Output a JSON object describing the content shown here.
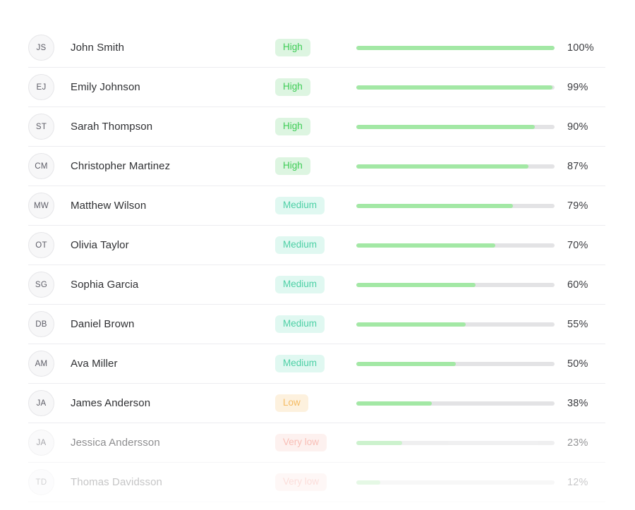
{
  "colors": {
    "background": "#ffffff",
    "divider": "#ededf0",
    "avatar_bg": "#f7f7f8",
    "avatar_border": "#e6e6e9",
    "avatar_text": "#5c5c66",
    "name_text": "#2f3033",
    "pct_text": "#3a3b3f",
    "bar_track": "#e3e3e5",
    "bar_fill": "#a3e8a5",
    "badge_high_bg": "#ddf5e1",
    "badge_high_text": "#3ecc56",
    "badge_medium_bg": "#e0f8f1",
    "badge_medium_text": "#4cd0a5",
    "badge_low_bg": "#fdf1de",
    "badge_low_text": "#f5bb62",
    "badge_verylow_bg": "#fde6e2",
    "badge_verylow_text": "#f4897c"
  },
  "chart_data": {
    "type": "bar",
    "title": "",
    "xlabel": "",
    "ylabel": "",
    "categories": [
      "John Smith",
      "Emily Johnson",
      "Sarah Thompson",
      "Christopher Martinez",
      "Matthew Wilson",
      "Olivia Taylor",
      "Sophia Garcia",
      "Daniel Brown",
      "Ava Miller",
      "James Anderson",
      "Jessica Andersson",
      "Thomas Davidsson"
    ],
    "values": [
      100,
      99,
      90,
      87,
      79,
      70,
      60,
      55,
      50,
      38,
      23,
      12
    ],
    "ylim": [
      0,
      100
    ],
    "grid": false,
    "legend": "none"
  },
  "rows": [
    {
      "initials": "JS",
      "name": "John Smith",
      "rating": "High",
      "rating_level": "high",
      "percent": 100,
      "percent_label": "100%",
      "fade": "none"
    },
    {
      "initials": "EJ",
      "name": "Emily Johnson",
      "rating": "High",
      "rating_level": "high",
      "percent": 99,
      "percent_label": "99%",
      "fade": "none"
    },
    {
      "initials": "ST",
      "name": "Sarah Thompson",
      "rating": "High",
      "rating_level": "high",
      "percent": 90,
      "percent_label": "90%",
      "fade": "none"
    },
    {
      "initials": "CM",
      "name": "Christopher Martinez",
      "rating": "High",
      "rating_level": "high",
      "percent": 87,
      "percent_label": "87%",
      "fade": "none"
    },
    {
      "initials": "MW",
      "name": "Matthew Wilson",
      "rating": "Medium",
      "rating_level": "medium",
      "percent": 79,
      "percent_label": "79%",
      "fade": "none"
    },
    {
      "initials": "OT",
      "name": "Olivia Taylor",
      "rating": "Medium",
      "rating_level": "medium",
      "percent": 70,
      "percent_label": "70%",
      "fade": "none"
    },
    {
      "initials": "SG",
      "name": "Sophia Garcia",
      "rating": "Medium",
      "rating_level": "medium",
      "percent": 60,
      "percent_label": "60%",
      "fade": "none"
    },
    {
      "initials": "DB",
      "name": "Daniel Brown",
      "rating": "Medium",
      "rating_level": "medium",
      "percent": 55,
      "percent_label": "55%",
      "fade": "none"
    },
    {
      "initials": "AM",
      "name": "Ava Miller",
      "rating": "Medium",
      "rating_level": "medium",
      "percent": 50,
      "percent_label": "50%",
      "fade": "none"
    },
    {
      "initials": "JA",
      "name": "James Anderson",
      "rating": "Low",
      "rating_level": "low",
      "percent": 38,
      "percent_label": "38%",
      "fade": "none"
    },
    {
      "initials": "JA",
      "name": "Jessica Andersson",
      "rating": "Very low",
      "rating_level": "verylow",
      "percent": 23,
      "percent_label": "23%",
      "fade": "fade-1"
    },
    {
      "initials": "TD",
      "name": "Thomas Davidsson",
      "rating": "Very low",
      "rating_level": "verylow",
      "percent": 12,
      "percent_label": "12%",
      "fade": "fade-2"
    }
  ]
}
